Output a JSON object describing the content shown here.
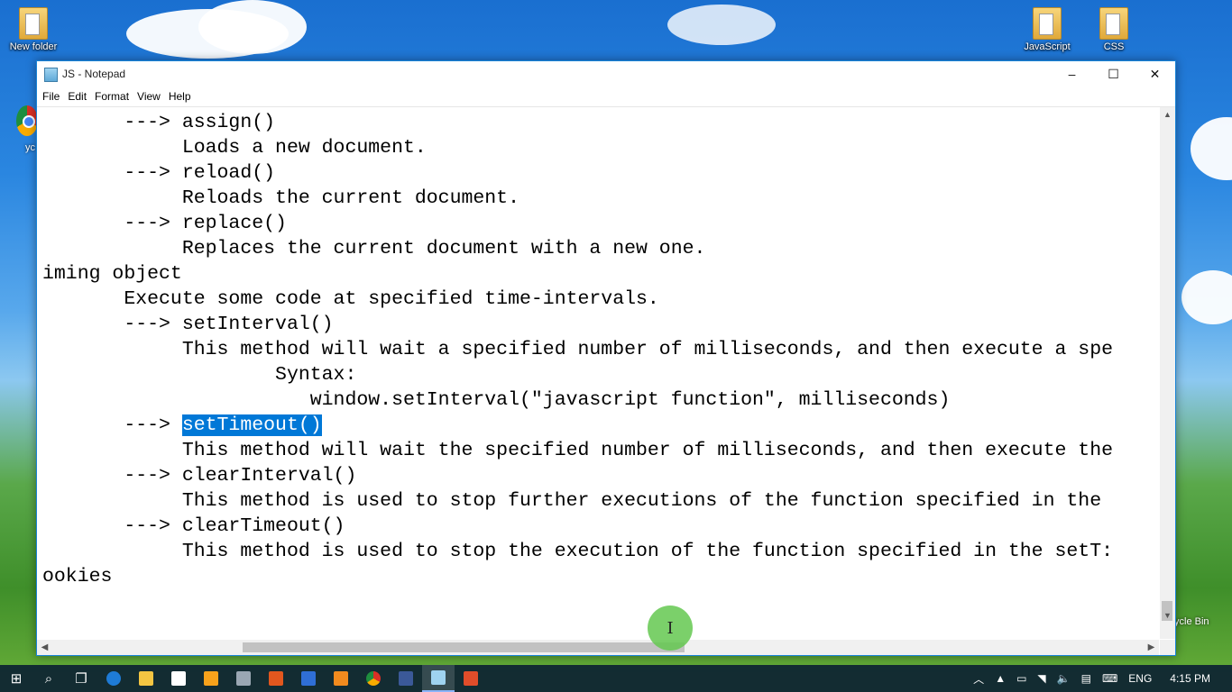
{
  "desktop": {
    "icons": [
      {
        "label": "New folder"
      },
      {
        "label": "JavaScript"
      },
      {
        "label": "CSS"
      },
      {
        "label": "ycle Bin"
      },
      {
        "label": "yc"
      }
    ]
  },
  "window": {
    "title": "JS - Notepad",
    "controls": {
      "minimize": "–",
      "maximize": "☐",
      "close": "✕"
    }
  },
  "menu": [
    {
      "label": "File"
    },
    {
      "label": "Edit"
    },
    {
      "label": "Format"
    },
    {
      "label": "View"
    },
    {
      "label": "Help"
    }
  ],
  "editor": {
    "lines": [
      "       ---> assign()",
      "            Loads a new document.",
      "       ---> reload()",
      "            Reloads the current document.",
      "       ---> replace()",
      "            Replaces the current document with a new one.",
      "iming object",
      "       Execute some code at specified time-intervals.",
      "       ---> setInterval()",
      "            This method will wait a specified number of milliseconds, and then execute a spe",
      "                    Syntax:",
      "                       window.setInterval(\"javascript function\", milliseconds)",
      "       ---> ",
      "            This method will wait the specified number of milliseconds, and then execute the",
      "       ---> clearInterval()",
      "            This method is used to stop further executions of the function specified in the",
      "       ---> clearTimeout()",
      "            This method is used to stop the execution of the function specified in the setT:",
      "ookies"
    ],
    "selected_text": "setTimeout()"
  },
  "scroll": {
    "up": "▲",
    "down": "▼",
    "left": "◀",
    "right": "▶"
  },
  "cursor": {
    "glyph": "I"
  },
  "taskbar": {
    "start": "⊞",
    "search": "⌕",
    "task_view": "❐",
    "tray": {
      "language": "ENG",
      "time": "4:15 PM"
    }
  }
}
